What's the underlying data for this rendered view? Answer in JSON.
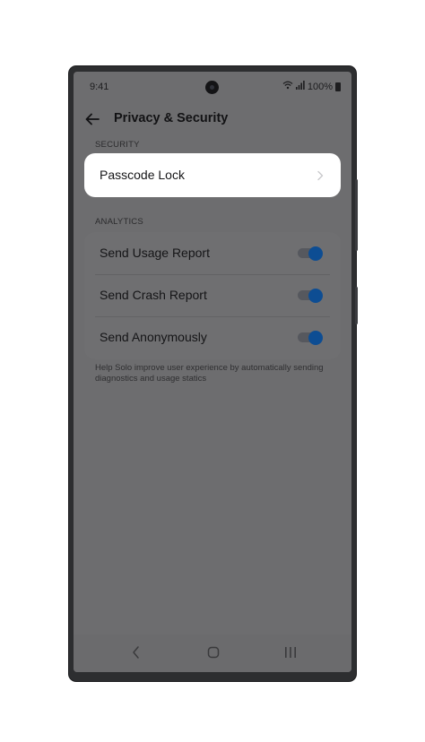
{
  "status_bar": {
    "time": "9:41",
    "battery_text": "100%"
  },
  "header": {
    "title": "Privacy & Security"
  },
  "security": {
    "section_label": "SECURITY",
    "passcode_label": "Passcode Lock"
  },
  "analytics": {
    "section_label": "ANALYTICS",
    "items": [
      {
        "label": "Send Usage Report",
        "enabled": true
      },
      {
        "label": "Send Crash Report",
        "enabled": true
      },
      {
        "label": "Send Anonymously",
        "enabled": true
      }
    ],
    "footer_note": "Help Solo improve user experience by automatically sending diagnostics and usage statics"
  },
  "colors": {
    "overlay": "#6d6d6f",
    "highlight_card": "#ffffff",
    "toggle_on": "#0d4d93"
  },
  "icons": {
    "back": "arrow-left-icon",
    "chevron": "chevron-right-icon",
    "wifi": "wifi-icon",
    "signal": "signal-icon",
    "battery": "battery-icon",
    "nav_back": "nav-back-icon",
    "nav_home": "nav-home-icon",
    "nav_recents": "nav-recents-icon"
  }
}
